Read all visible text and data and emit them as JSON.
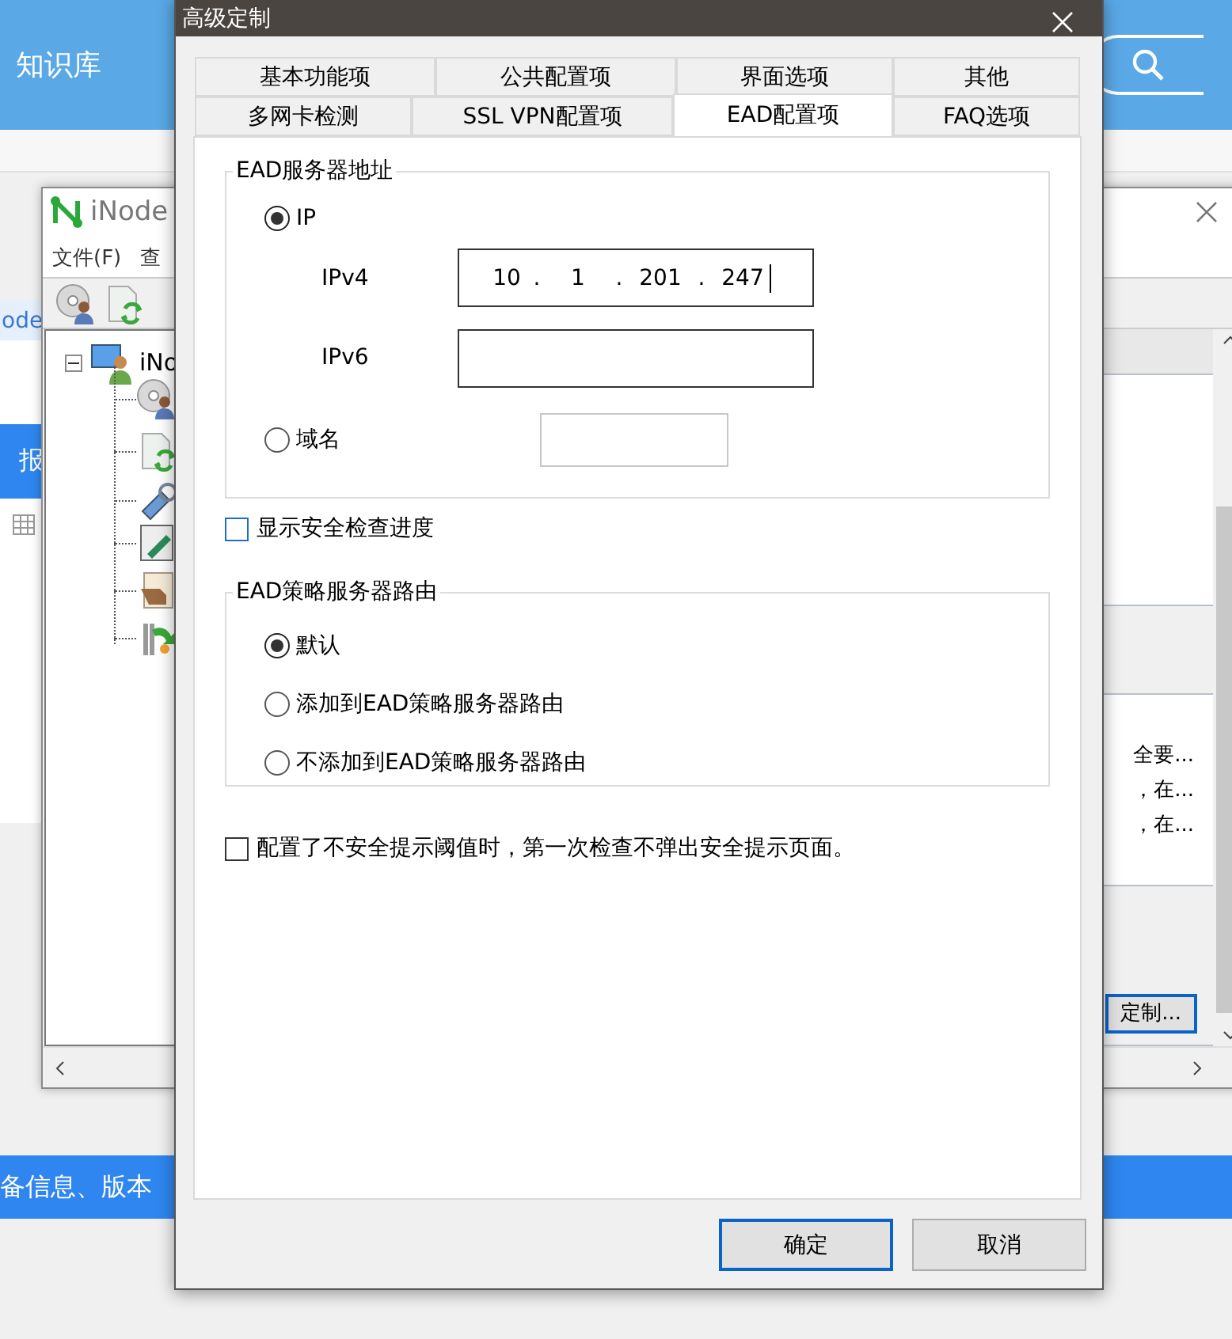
{
  "background_page": {
    "header_title": "知识库",
    "strip_text": "ode",
    "banner_text": "报",
    "footer_text": "备信息、版本"
  },
  "inode_window": {
    "title": "iNode",
    "menu": [
      "文件(F)",
      "查"
    ],
    "tree_root": {
      "label": "iNo",
      "expanded": true
    },
    "summary_lines": [
      "全要...",
      "，在...",
      "，在..."
    ],
    "customize_button": "定制..."
  },
  "dialog": {
    "title": "高级定制",
    "tab_rows": [
      [
        {
          "label": "基本功能项",
          "selected": false
        },
        {
          "label": "公共配置项",
          "selected": false
        },
        {
          "label": "界面选项",
          "selected": false
        },
        {
          "label": "其他",
          "selected": false
        }
      ],
      [
        {
          "label": "多网卡检测",
          "selected": false
        },
        {
          "label": "SSL VPN配置项",
          "selected": false
        },
        {
          "label": "EAD配置项",
          "selected": true
        },
        {
          "label": "FAQ选项",
          "selected": false
        }
      ]
    ],
    "server_group": {
      "title": "EAD服务器地址",
      "ip_option": {
        "label": "IP",
        "selected": true
      },
      "ipv4_label": "IPv4",
      "ipv4_segments": [
        "10",
        "1",
        "201",
        "247"
      ],
      "ipv4_separator": ".",
      "ipv6_label": "IPv6",
      "domain_option": {
        "label": "域名",
        "selected": false
      }
    },
    "show_progress": {
      "label": "显示安全检查进度",
      "checked": false
    },
    "route_group": {
      "title": "EAD策略服务器路由",
      "options": [
        {
          "label": "默认",
          "selected": true
        },
        {
          "label": "添加到EAD策略服务器路由",
          "selected": false
        },
        {
          "label": "不添加到EAD策略服务器路由",
          "selected": false
        }
      ]
    },
    "skip_prompt": {
      "label": "配置了不安全提示阈值时，第一次检查不弹出安全提示页面。",
      "checked": false
    },
    "buttons": [
      {
        "label": "确定",
        "kind": "default"
      },
      {
        "label": "取消",
        "kind": "normal"
      }
    ]
  }
}
